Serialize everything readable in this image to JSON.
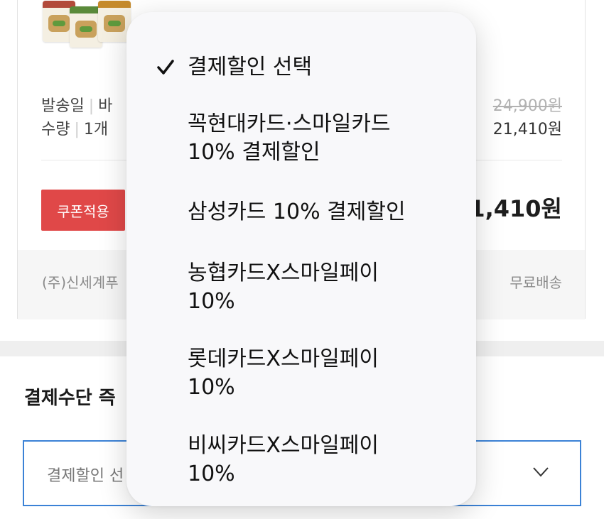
{
  "order": {
    "info_lines": [
      {
        "label": "발송일",
        "value": "바"
      },
      {
        "label": "수량",
        "value": "1개"
      }
    ],
    "original_price": "24,900원",
    "sale_price": "21,410원",
    "coupon_button": "쿠폰적용",
    "total_partial": "1,410원",
    "seller": "(주)신세계푸",
    "shipping": "무료배송"
  },
  "payment": {
    "section_title": "결제수단 즉",
    "select_value": "결제할인 선"
  },
  "dropdown": {
    "options": [
      {
        "label": "결제할인 선택",
        "selected": true
      },
      {
        "label": "꼭현대카드·스마일카드\n10% 결제할인",
        "selected": false
      },
      {
        "label": "삼성카드 10% 결제할인",
        "selected": false
      },
      {
        "label": "농협카드X스마일페이\n10%",
        "selected": false
      },
      {
        "label": "롯데카드X스마일페이\n10%",
        "selected": false
      },
      {
        "label": "비씨카드X스마일페이\n10%",
        "selected": false
      }
    ]
  },
  "colors": {
    "coupon_red": "#e04848",
    "select_border_blue": "#3b82d6"
  },
  "icons": [
    "checkmark-icon",
    "chevron-down-icon"
  ]
}
